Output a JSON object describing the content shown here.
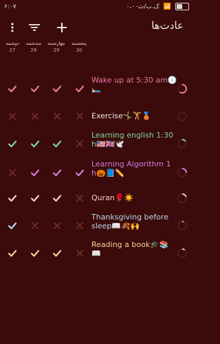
{
  "status": {
    "time": "۶:۰۷",
    "right_text": "۰،۰۰ک.ب/ث"
  },
  "appbar": {
    "title": "عادت‌ها",
    "icons": [
      "kebab-icon",
      "filter-icon",
      "plus-icon"
    ]
  },
  "days": [
    {
      "name": "دوشنبه",
      "num": "27"
    },
    {
      "name": "سه‌شنبه",
      "num": "28"
    },
    {
      "name": "چهارشنبه",
      "num": "29"
    },
    {
      "name": "پنجشنبه",
      "num": "30"
    }
  ],
  "habits": [
    {
      "name": "Wake up at 5:30 am🕔🛏️",
      "color": "#e57aa6",
      "marks": [
        "check",
        "check",
        "check",
        "check"
      ],
      "progress": 0.6
    },
    {
      "name": "Exercise🤸‍♂️🏋️🥉",
      "color": "#f2e7e7",
      "marks": [
        "x",
        "x",
        "x",
        "x"
      ],
      "progress": 0.0
    },
    {
      "name": "Learning english 1:30 h🇺🇸🇬🇧🕊️",
      "color": "#7ed6a0",
      "marks": [
        "check",
        "check",
        "check",
        "x"
      ],
      "progress": 0.15
    },
    {
      "name": "Learning Algorithm 1 h🎃📘✏️",
      "color": "#d77be0",
      "marks": [
        "x",
        "check",
        "check",
        "check"
      ],
      "progress": 0.25
    },
    {
      "name": "Quran🌹☀️",
      "color": "#f5d0d6",
      "marks": [
        "check",
        "check",
        "check",
        "x"
      ],
      "progress": 0.2
    },
    {
      "name": "Thanksgiving before sleep📖🍂🙌",
      "color": "#b8dcee",
      "marks": [
        "check",
        "x",
        "x",
        "x"
      ],
      "progress": 0.05
    },
    {
      "name": "Reading a book🎓📚📖",
      "color": "#f6d59a",
      "marks": [
        "check",
        "check",
        "check",
        "x"
      ],
      "progress": 0.1
    }
  ]
}
